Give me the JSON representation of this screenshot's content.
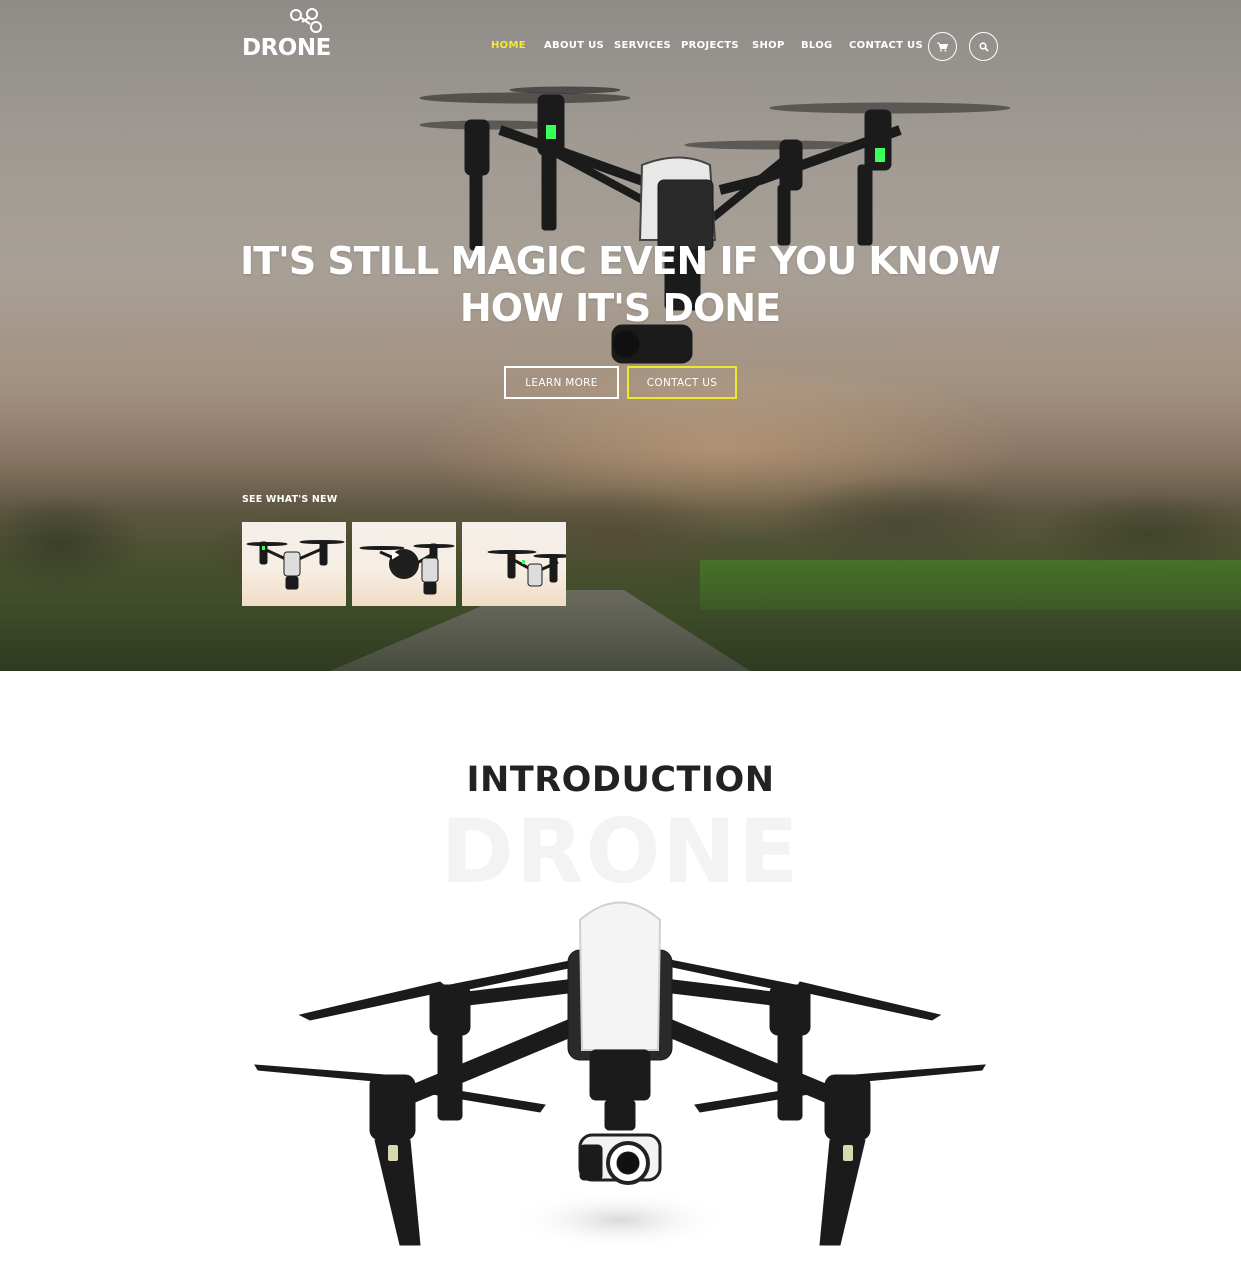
{
  "brand": {
    "name": "DRONE",
    "logo_icon": "drone-logo-icon"
  },
  "nav": {
    "items": [
      {
        "label": "HOME",
        "active": true
      },
      {
        "label": "ABOUT US",
        "active": false
      },
      {
        "label": "SERVICES",
        "active": false
      },
      {
        "label": "PROJECTS",
        "active": false
      },
      {
        "label": "SHOP",
        "active": false
      },
      {
        "label": "BLOG",
        "active": false
      },
      {
        "label": "CONTACT US",
        "active": false
      }
    ],
    "cart_icon": "cart-icon",
    "search_icon": "search-icon",
    "active_color": "#f0ea3a"
  },
  "hero": {
    "title_line1": "IT'S STILL MAGIC EVEN IF YOU KNOW",
    "title_line2": "HOW IT'S DONE",
    "learn_more_label": "LEARN MORE",
    "contact_label": "CONTACT US",
    "contact_border_color": "#eee92e",
    "whats_new_label": "SEE WHAT'S NEW",
    "thumbnails": [
      {
        "icon": "drone-thumbnail",
        "has_play": false
      },
      {
        "icon": "drone-thumbnail",
        "has_play": true
      },
      {
        "icon": "drone-thumbnail",
        "has_play": false
      }
    ]
  },
  "intro": {
    "title": "INTRODUCTION",
    "watermark": "DRONE"
  }
}
